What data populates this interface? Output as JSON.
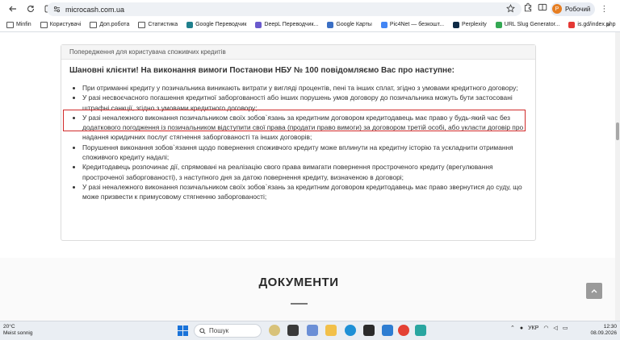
{
  "browser": {
    "url": "microcash.com.ua",
    "profile_name": "Робочий",
    "profile_initial": "Р",
    "bookmarks": [
      {
        "label": "Minfin",
        "icon": "folder-icon"
      },
      {
        "label": "Користувачі",
        "icon": "folder-icon"
      },
      {
        "label": "Доп.робота",
        "icon": "folder-icon"
      },
      {
        "label": "Статистика",
        "icon": "folder-icon"
      },
      {
        "label": "Google Переводчик",
        "icon": "google-translate-icon"
      },
      {
        "label": "DeepL Переводчик...",
        "icon": "deepl-icon"
      },
      {
        "label": "Google Карты",
        "icon": "google-maps-icon"
      },
      {
        "label": "Pic4Net — безкошт...",
        "icon": "pic4net-icon"
      },
      {
        "label": "Perplexity",
        "icon": "perplexity-icon"
      },
      {
        "label": "URL Slug Generator...",
        "icon": "url-slug-icon"
      },
      {
        "label": "is.gd/index.php",
        "icon": "isgd-icon"
      }
    ],
    "more_bookmarks": "»"
  },
  "warning": {
    "header": "Попередження для користувача споживчих кредитів",
    "lead": "Шановні клієнти! На виконання вимоги Постанови НБУ № 100 повідомляємо Вас про наступне:",
    "items": [
      "При отриманні кредиту у позичальника виникають витрати у вигляді процентів, пені та інших сплат, згідно з умовами кредитного договору;",
      "У разі несвоєчасного погашення кредитної заборгованості або інших порушень умов договору до позичальника можуть бути застосовані штрафні санкції, згідно з умовами кредитного договору;",
      "У разі неналежного виконання позичальником своїх зобов`язань за кредитним договором кредитодавець має право у будь-який час без додаткового погодження із позичальником відступити свої права (продати право вимоги) за договором третій особі, або укласти договір про надання юридичних послуг стягнення заборгованості та інших договорів;",
      "Порушення виконання зобов`язання щодо повернення споживчого кредиту може вплинути на кредитну історію та ускладнити отримання споживчого кредиту надалі;",
      "Кредитодавець розпочинає дії, спрямовані на реалізацію свого права вимагати повернення простроченого кредиту (врегулювання простроченої заборгованості), з наступного дня за датою повернення кредиту, визначеною в договорі;",
      "У разі неналежного виконання позичальником своїх зобов`язань за кредитним договором кредитодавець має право звернутися до суду, що може призвести к примусовому стягненню заборгованості;"
    ],
    "highlighted_item_index": 1,
    "highlight_color": "#d12b2b"
  },
  "documents": {
    "title": "ДОКУМЕНТИ"
  },
  "taskbar": {
    "weather_temp": "20°C",
    "weather_desc": "Meist sonnig",
    "search_placeholder": "Пошук",
    "language": "УКР",
    "time": "12:30",
    "date": "08.09.2026"
  }
}
